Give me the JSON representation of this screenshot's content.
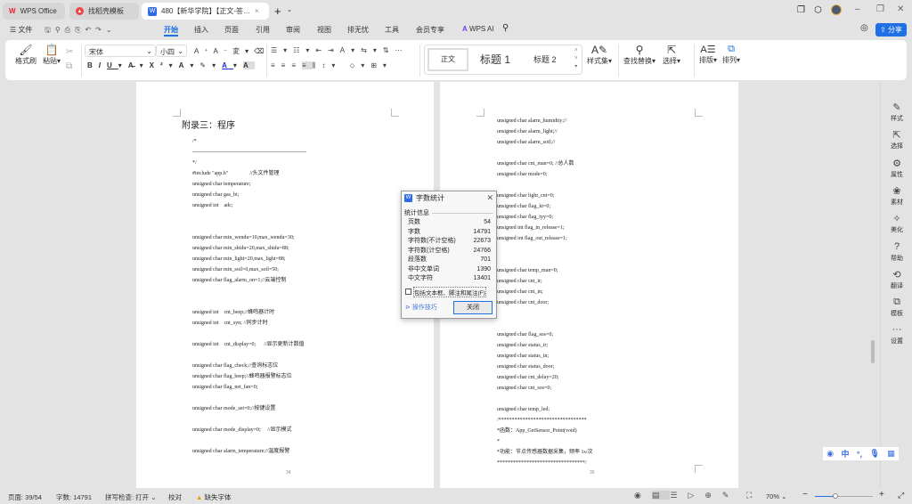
{
  "tabs": [
    {
      "label": "WPS Office"
    },
    {
      "label": "找稻壳模板"
    },
    {
      "label": "480【新华学院】【正文-答…"
    }
  ],
  "menu": {
    "file": "文件",
    "items": [
      "开始",
      "插入",
      "页面",
      "引用",
      "审阅",
      "视图",
      "排无忧",
      "工具",
      "会员专享"
    ],
    "ai": "WPS AI",
    "share": "分享"
  },
  "ribbon": {
    "format_painter": "格式刷",
    "paste": "粘贴",
    "font": "宋体",
    "size": "小四",
    "styles": [
      "正文",
      "标题 1",
      "标题 2"
    ],
    "style_set": "样式集",
    "find_replace": "查找替换",
    "select": "选择",
    "layout": "排版",
    "arrange": "排列"
  },
  "doc": {
    "left": {
      "heading": "附录三：程序",
      "page_no": "34",
      "lines": [
        "/*",
        "----------------------------------------------------------------",
        "*/",
        "#include \"app.h\"                //头文件管理",
        "unsigned char temperature;",
        "unsigned char gas_bi;",
        "unsigned int    adc;",
        "unsigned char min_wendu=10,max_wendu=30;",
        "unsigned char min_shidu=20,max_shidu=88;",
        "unsigned char min_light=20,max_light=88;",
        "unsigned char min_soil=0,max_soil=50;",
        "unsigned char flag_alarm_on=1;//云端控制",
        "unsigned int    cnt_beep;//蜂鸣器计时",
        "unsigned int    cnt_syn; //同步计时",
        "unsigned int    cnt_display=0;      //显示更新计数值",
        "unsigned char flag_check;//查询标志位",
        "unsigned char flag_beep;//蜂鸣器报警标志位",
        "unsigned char flag_net_fan=0;",
        "unsigned char mode_set=0;//按键设置",
        "unsigned char mode_display=0;     //显示模式",
        "unsigned char alarm_temperature;//温度报警"
      ]
    },
    "right": {
      "page_no": "35",
      "lines": [
        "unsigned char alarm_humidity;//",
        "unsigned char alarm_light;//",
        "unsigned char alarm_soil;//",
        "unsigned char cnt_man=0; //总人数",
        "unsigned char mode=0;",
        "unsigned char light_cnt=0;",
        "unsigned char flag_kt=0;",
        "unsigned char flag_tyy=0;",
        "unsigned int flag_in_release=1;",
        "unsigned int flag_out_release=1;",
        "unsigned char temp_man=0;",
        "unsigned char cnt_ir;",
        "unsigned char cnt_in;",
        "unsigned char cnt_door;",
        "unsigned char flag_sos=0;",
        "unsigned char status_ir;",
        "unsigned char status_in;",
        "unsigned char status_door;",
        "unsigned char cnt_delay=20;",
        "unsigned char cnt_sos=0;",
        "unsigned char temp_led;",
        "/*********************************",
        "*函数：App_GetSensor_Point(void)",
        "*",
        "*功能：节点传感器数据采集，频率 1s/次",
        "*********************************/"
      ]
    }
  },
  "dialog": {
    "title": "字数统计",
    "section": "统计信息",
    "rows": [
      {
        "label": "页数",
        "value": "54"
      },
      {
        "label": "字数",
        "value": "14791"
      },
      {
        "label": "字符数(不计空格)",
        "value": "22673"
      },
      {
        "label": "字符数(计空格)",
        "value": "24766"
      },
      {
        "label": "段落数",
        "value": "701"
      },
      {
        "label": "非中文单词",
        "value": "1390"
      },
      {
        "label": "中文字符",
        "value": "13401"
      }
    ],
    "checkbox": "包括文本框、脚注和尾注(F)",
    "tips": "操作技巧",
    "close": "关闭"
  },
  "sidebar": [
    "样式",
    "选择",
    "属性",
    "素材",
    "美化",
    "帮助",
    "翻译",
    "模板",
    "设置"
  ],
  "status": {
    "page": "页面: 39/54",
    "words": "字数: 14791",
    "spell": "拼写检查: 打开",
    "proof": "校对",
    "missing_font": "缺失字体",
    "zoom": "70%",
    "zoom_fraction": 0.35
  },
  "ime": {
    "mode": "中"
  },
  "colors": {
    "accent": "#1f6fe5",
    "tab_bg": "#e3e3e3"
  }
}
